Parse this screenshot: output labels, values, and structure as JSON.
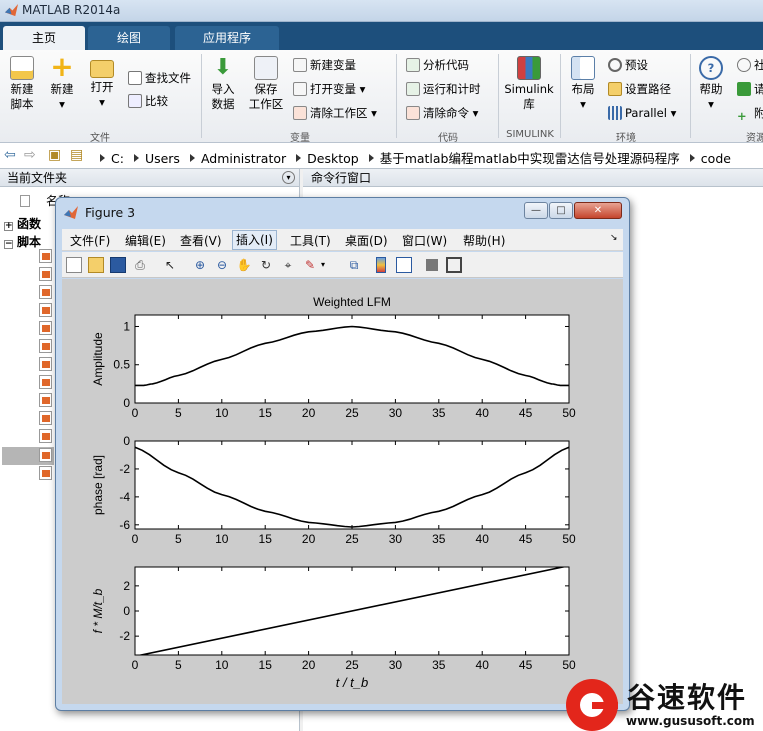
{
  "app": {
    "title": "MATLAB R2014a"
  },
  "tabs": [
    "主页",
    "绘图",
    "应用程序"
  ],
  "ribbon": {
    "new_script": "新建\n脚本",
    "new": "新建",
    "open": "打开",
    "find_files": "查找文件",
    "compare": "比较",
    "import_data": "导入\n数据",
    "save_workspace": "保存\n工作区",
    "new_variable": "新建变量",
    "open_variable": "打开变量",
    "clear_workspace": "清除工作区",
    "analyze_code": "分析代码",
    "run_and_time": "运行和计时",
    "clear_commands": "清除命令",
    "simulink": "Simulink\n库",
    "layout": "布局",
    "preferences": "预设",
    "set_path": "设置路径",
    "parallel": "Parallel",
    "help": "帮助",
    "groups": {
      "file": "文件",
      "variable": "变量",
      "code": "代码",
      "simulink": "SIMULINK",
      "environment": "环境",
      "resources": "资源"
    },
    "cut_right_1": "社",
    "cut_right_2": "请",
    "cut_right_3": "附"
  },
  "address": {
    "crumbs": [
      "C:",
      "Users",
      "Administrator",
      "Desktop",
      "基于matlab编程matlab中实现雷达信号处理源码程序",
      "code"
    ]
  },
  "current_folder": {
    "title": "当前文件夹",
    "name_col": "名称",
    "nodes": [
      "函数",
      "脚本"
    ]
  },
  "command_window": {
    "title": "命令行窗口"
  },
  "figure": {
    "title": "Figure 3",
    "menu": [
      "文件(F)",
      "编辑(E)",
      "查看(V)",
      "插入(I)",
      "工具(T)",
      "桌面(D)",
      "窗口(W)",
      "帮助(H)"
    ],
    "active_menu": "插入(I)",
    "win_controls": {
      "minimize": "—",
      "maximize": "□",
      "close": "✕"
    }
  },
  "chart_data": [
    {
      "type": "line",
      "title": "Weighted LFM",
      "xlabel": "",
      "ylabel": "Amplitude",
      "xlim": [
        0,
        50
      ],
      "ylim": [
        0,
        1.15
      ],
      "xticks": [
        0,
        5,
        10,
        15,
        20,
        25,
        30,
        35,
        40,
        45,
        50
      ],
      "yticks": [
        0,
        0.5,
        1
      ],
      "x": [
        0,
        1,
        2,
        5,
        10,
        15,
        20,
        25,
        30,
        35,
        40,
        45,
        48,
        49,
        50
      ],
      "y": [
        0.23,
        0.23,
        0.25,
        0.36,
        0.57,
        0.78,
        0.93,
        1.0,
        0.93,
        0.78,
        0.57,
        0.36,
        0.25,
        0.23,
        0.23
      ]
    },
    {
      "type": "line",
      "title": "",
      "xlabel": "",
      "ylabel": "phase [rad]",
      "xlim": [
        0,
        50
      ],
      "ylim": [
        -6.3,
        0
      ],
      "xticks": [
        0,
        5,
        10,
        15,
        20,
        25,
        30,
        35,
        40,
        45,
        50
      ],
      "yticks": [
        0,
        -2,
        -4,
        -6
      ],
      "x": [
        0,
        5,
        10,
        15,
        20,
        25,
        30,
        35,
        40,
        45,
        50
      ],
      "y": [
        -0.45,
        -2.27,
        -3.84,
        -5.03,
        -5.83,
        -6.16,
        -5.83,
        -5.03,
        -3.84,
        -2.27,
        -0.45
      ]
    },
    {
      "type": "line",
      "title": "",
      "xlabel": "t / t_b",
      "ylabel": "f * M/t_b",
      "xlim": [
        0,
        50
      ],
      "ylim": [
        -3.5,
        3.5
      ],
      "xticks": [
        0,
        5,
        10,
        15,
        20,
        25,
        30,
        35,
        40,
        45,
        50
      ],
      "yticks": [
        2,
        0,
        -2
      ],
      "x": [
        0,
        50
      ],
      "y": [
        -3.6,
        3.6
      ]
    }
  ],
  "watermark": {
    "name": "谷速软件",
    "url": "www.gususoft.com"
  },
  "colors": {
    "matlab_blue": "#1d4f7c",
    "window_frame": "#c5d8ee",
    "plot_bg": "#cccccc",
    "watermark_red": "#e3261b"
  }
}
